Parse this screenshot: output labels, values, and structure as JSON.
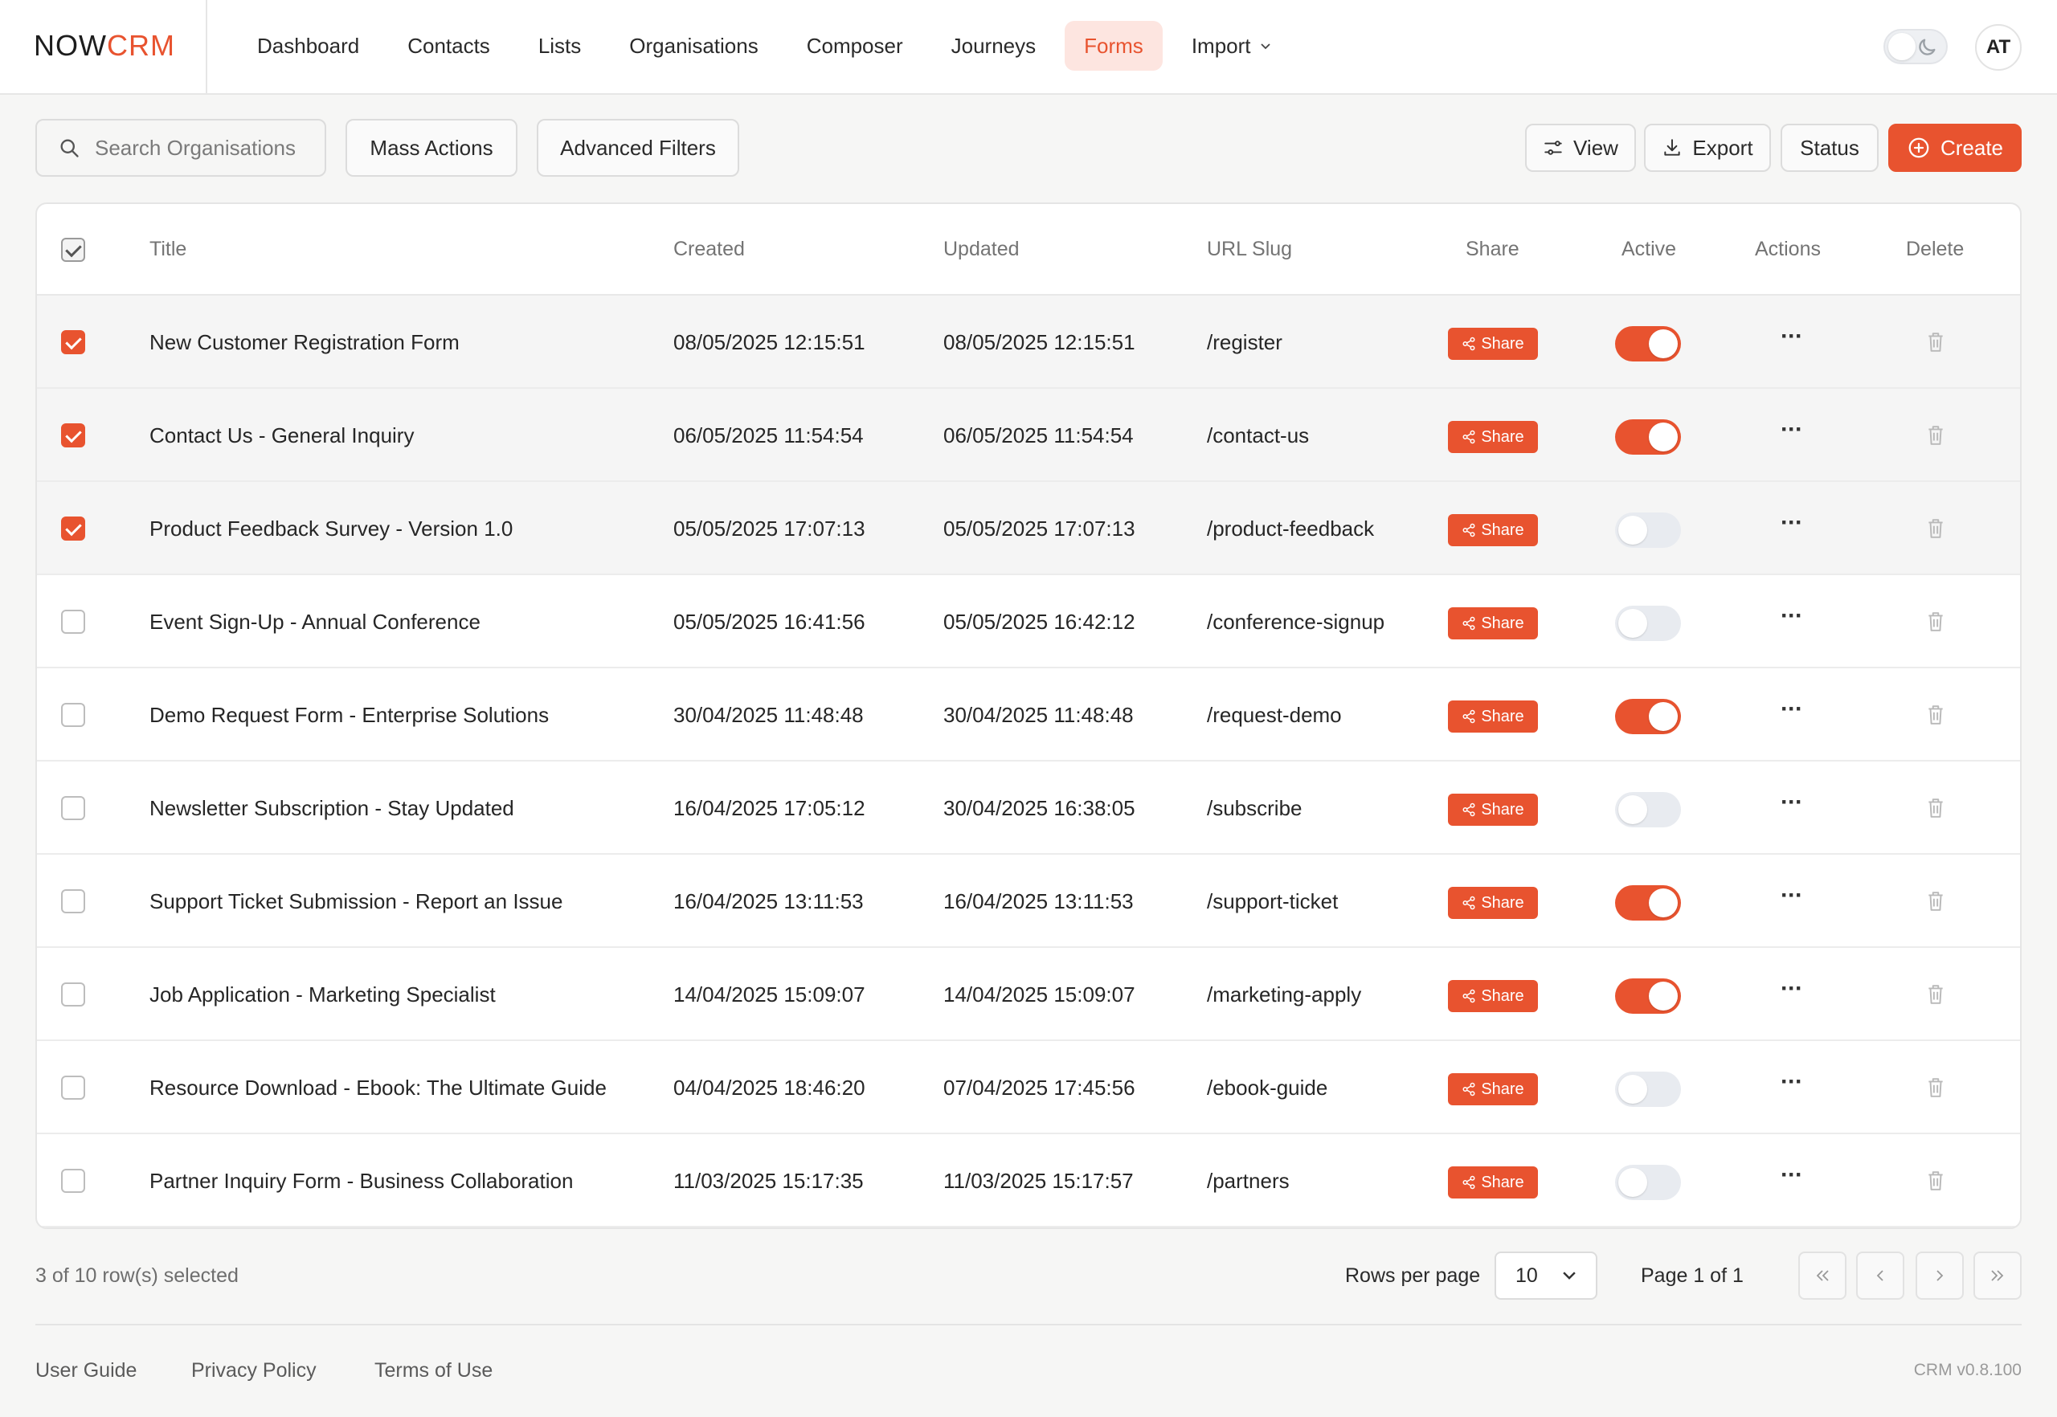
{
  "brand": {
    "part1": "NOW",
    "part2": "CRM"
  },
  "nav": [
    {
      "label": "Dashboard"
    },
    {
      "label": "Contacts"
    },
    {
      "label": "Lists"
    },
    {
      "label": "Organisations"
    },
    {
      "label": "Composer"
    },
    {
      "label": "Journeys"
    },
    {
      "label": "Forms",
      "active": true
    },
    {
      "label": "Import",
      "dropdown": true
    }
  ],
  "user": {
    "initials": "AT"
  },
  "theme": {
    "mode": "light",
    "icon": "moon-icon"
  },
  "toolbar": {
    "search_placeholder": "Search Organisations",
    "mass_actions": "Mass Actions",
    "advanced_filters": "Advanced Filters",
    "view": "View",
    "export": "Export",
    "status": "Status",
    "create": "Create"
  },
  "colors": {
    "accent": "#e8532f",
    "accent_light": "#fde5e0"
  },
  "table": {
    "columns": [
      "Title",
      "Created",
      "Updated",
      "URL Slug",
      "Share",
      "Active",
      "Actions",
      "Delete"
    ],
    "share_label": "Share",
    "rows": [
      {
        "selected": true,
        "title": "New Customer Registration Form",
        "created": "08/05/2025 12:15:51",
        "updated": "08/05/2025 12:15:51",
        "slug": "/register",
        "active": true
      },
      {
        "selected": true,
        "title": "Contact Us - General Inquiry",
        "created": "06/05/2025 11:54:54",
        "updated": "06/05/2025 11:54:54",
        "slug": "/contact-us",
        "active": true
      },
      {
        "selected": true,
        "title": "Product Feedback Survey - Version 1.0",
        "created": "05/05/2025 17:07:13",
        "updated": "05/05/2025 17:07:13",
        "slug": "/product-feedback",
        "active": false
      },
      {
        "selected": false,
        "title": "Event Sign-Up - Annual Conference",
        "created": "05/05/2025 16:41:56",
        "updated": "05/05/2025 16:42:12",
        "slug": "/conference-signup",
        "active": false
      },
      {
        "selected": false,
        "title": "Demo Request Form - Enterprise Solutions",
        "created": "30/04/2025 11:48:48",
        "updated": "30/04/2025 11:48:48",
        "slug": "/request-demo",
        "active": true
      },
      {
        "selected": false,
        "title": "Newsletter Subscription - Stay Updated",
        "created": "16/04/2025 17:05:12",
        "updated": "30/04/2025 16:38:05",
        "slug": "/subscribe",
        "active": false
      },
      {
        "selected": false,
        "title": "Support Ticket Submission - Report an Issue",
        "created": "16/04/2025 13:11:53",
        "updated": "16/04/2025 13:11:53",
        "slug": "/support-ticket",
        "active": true
      },
      {
        "selected": false,
        "title": "Job Application - Marketing Specialist",
        "created": "14/04/2025 15:09:07",
        "updated": "14/04/2025 15:09:07",
        "slug": "/marketing-apply",
        "active": true
      },
      {
        "selected": false,
        "title": "Resource Download - Ebook: The Ultimate Guide",
        "created": "04/04/2025 18:46:20",
        "updated": "07/04/2025 17:45:56",
        "slug": "/ebook-guide",
        "active": false
      },
      {
        "selected": false,
        "title": "Partner Inquiry Form - Business Collaboration",
        "created": "11/03/2025 15:17:35",
        "updated": "11/03/2025 15:17:57",
        "slug": "/partners",
        "active": false
      }
    ]
  },
  "pagination": {
    "selected_text": "3 of 10  row(s) selected",
    "rows_per_page_label": "Rows per page",
    "rows_per_page": "10",
    "page_text": "Page 1  of  1"
  },
  "footer": {
    "links": [
      "User Guide",
      "Privacy Policy",
      "Terms of Use"
    ],
    "version": "CRM v0.8.100"
  }
}
